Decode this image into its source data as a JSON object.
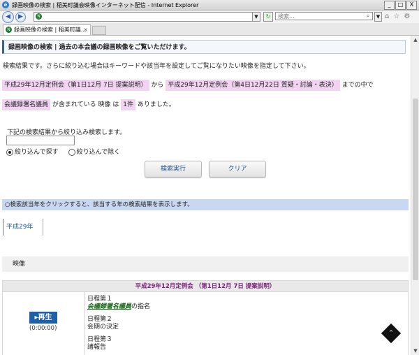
{
  "window": {
    "title": "録画映像の検索 | 稲美町議会映像インターネット配信 - Internet Explorer",
    "controls": {
      "minimize": "_",
      "maximize": "□",
      "close": "X"
    }
  },
  "toolbar": {
    "back": "◀",
    "forward": "▶",
    "address_value": "",
    "search_placeholder": "検索...",
    "search_icon": "⌕",
    "icons": [
      "home-icon",
      "star-icon",
      "gear-icon"
    ]
  },
  "tab": {
    "label": "録画映像の検索 | 稲美町議...",
    "close": "×"
  },
  "page": {
    "header": "録画映像の検索 | 過去の本会議の録画映像をご覧いただけます。",
    "info": "検索結果です。さらに絞り込む場合はキーワードや該当年を設定してご覧になりたい映像を指定して下さい。",
    "criteria": {
      "from": "平成29年12月定例会（第1日12月 7日 提案説明）",
      "from_suffix": "から",
      "to": "平成29年12月定例会（第4日12月22日 質疑・討論・表決）",
      "to_suffix": "までの中で",
      "keyword": "会議録署名議員",
      "keyword_suffix": "が含まれている",
      "video_label": "映像 は",
      "count": "1件",
      "count_suffix": "ありました。"
    },
    "refine": {
      "label": "下記の検索結果から絞り込み検索します。",
      "input_value": "",
      "radio_include": "絞り込んで探す",
      "radio_exclude": "絞り込んで除く",
      "selected": "include"
    },
    "buttons": {
      "search": "検索実行",
      "clear": "クリア"
    },
    "notice": "○検索該当年をクリックすると、該当する年の検索結果を表示します。",
    "year_tabs": [
      "平成29年"
    ],
    "video_section": "映像",
    "meeting": "平成29年12月定例会 （第1日12月 7日 提案説明）",
    "result": {
      "play_label": "再生",
      "play_time": "(0:00:00)",
      "agenda": [
        {
          "title": "日程第１",
          "link": "会議録署名議員",
          "text": "の指名"
        },
        {
          "title": "日程第２",
          "link": "",
          "text": "会期の決定"
        },
        {
          "title": "日程第３",
          "link": "",
          "text": "諸報告"
        }
      ]
    },
    "back_to_top": "⌃"
  }
}
